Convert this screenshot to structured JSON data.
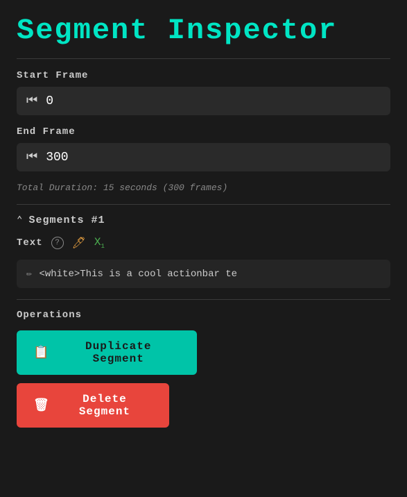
{
  "page": {
    "title": "Segment Inspector"
  },
  "start_frame": {
    "label": "Start Frame",
    "value": "0",
    "icon": "skip-to-start"
  },
  "end_frame": {
    "label": "End Frame",
    "value": "300",
    "icon": "skip-to-start"
  },
  "total_duration": {
    "text": "Total Duration: 15 seconds (300 frames)"
  },
  "segments": {
    "header": "Segments #1",
    "text_label": "Text",
    "content": "<white>This is a cool actionbar te"
  },
  "operations": {
    "label": "Operations",
    "duplicate_button": "Duplicate Segment",
    "delete_button": "Delete Segment",
    "duplicate_icon": "📋",
    "delete_icon": "🗑"
  }
}
